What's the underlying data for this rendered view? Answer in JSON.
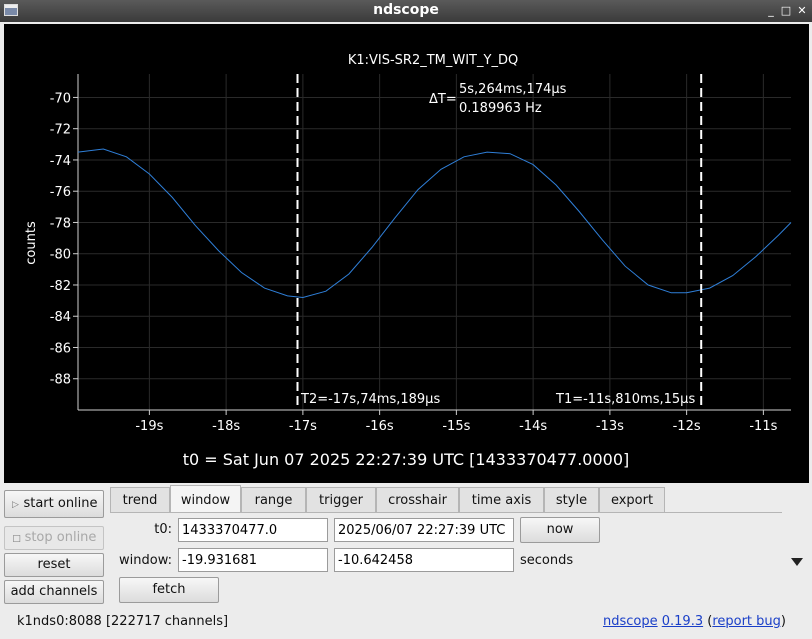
{
  "window": {
    "title": "ndscope"
  },
  "plot": {
    "channel_title": "K1:VIS-SR2_TM_WIT_Y_DQ",
    "ylabel": "counts",
    "y_ticks": [
      "-70",
      "-72",
      "-74",
      "-76",
      "-78",
      "-80",
      "-82",
      "-84",
      "-86",
      "-88"
    ],
    "x_ticks": [
      "-19s",
      "-18s",
      "-17s",
      "-16s",
      "-15s",
      "-14s",
      "-13s",
      "-12s",
      "-11s"
    ],
    "delta_t_label": "ΔT=",
    "delta_t_value": "5s,264ms,174µs",
    "delta_freq": "0.189963 Hz",
    "t2_label": "T2=-17s,74ms,189µs",
    "t1_label": "T1=-11s,810ms,15µs",
    "t0_text": "t0 = Sat Jun 07 2025 22:27:39 UTC [1433370477.0000]",
    "colors": {
      "trace": "#2f7fd8",
      "cursor": "#ffffff",
      "grid": "#2a2a2a",
      "background": "#000000"
    }
  },
  "chart_data": {
    "type": "line",
    "title": "K1:VIS-SR2_TM_WIT_Y_DQ",
    "xlabel": "",
    "ylabel": "counts",
    "xlim": [
      -19.93,
      -10.64
    ],
    "ylim": [
      -90,
      -68.5
    ],
    "grid": true,
    "series": [
      {
        "name": "K1:VIS-SR2_TM_WIT_Y_DQ",
        "x": [
          -19.93,
          -19.6,
          -19.3,
          -19.0,
          -18.7,
          -18.4,
          -18.1,
          -17.8,
          -17.5,
          -17.2,
          -17.0,
          -16.7,
          -16.4,
          -16.1,
          -15.8,
          -15.5,
          -15.2,
          -14.9,
          -14.6,
          -14.3,
          -14.0,
          -13.7,
          -13.4,
          -13.1,
          -12.8,
          -12.5,
          -12.2,
          -12.0,
          -11.7,
          -11.4,
          -11.1,
          -10.8,
          -10.64
        ],
        "y": [
          -73.5,
          -73.3,
          -73.8,
          -74.9,
          -76.4,
          -78.2,
          -79.8,
          -81.2,
          -82.2,
          -82.7,
          -82.8,
          -82.4,
          -81.3,
          -79.6,
          -77.7,
          -75.9,
          -74.6,
          -73.8,
          -73.5,
          -73.6,
          -74.3,
          -75.6,
          -77.3,
          -79.1,
          -80.8,
          -82.0,
          -82.5,
          -82.5,
          -82.2,
          -81.4,
          -80.2,
          -78.8,
          -78.0
        ]
      }
    ],
    "cursors": {
      "t1": -11.81,
      "t2": -17.07
    }
  },
  "tabs": [
    "trend",
    "window",
    "range",
    "trigger",
    "crosshair",
    "time axis",
    "style",
    "export"
  ],
  "active_tab": "window",
  "sidebar": {
    "start_online": "start online",
    "stop_online": "stop online",
    "reset": "reset",
    "add_channels": "add channels"
  },
  "window_panel": {
    "t0_label": "t0:",
    "t0_gps": "1433370477.0",
    "t0_utc": "2025/06/07 22:27:39 UTC",
    "now": "now",
    "window_label": "window:",
    "window_start": "-19.931681",
    "window_end": "-10.642458",
    "seconds": "seconds",
    "fetch": "fetch"
  },
  "status": {
    "server": "k1nds0:8088",
    "channels": "[222717 channels]"
  },
  "footer": {
    "app": "ndscope",
    "version": "0.19.3",
    "open_paren": " (",
    "report": "report bug",
    "close_paren": ")"
  }
}
